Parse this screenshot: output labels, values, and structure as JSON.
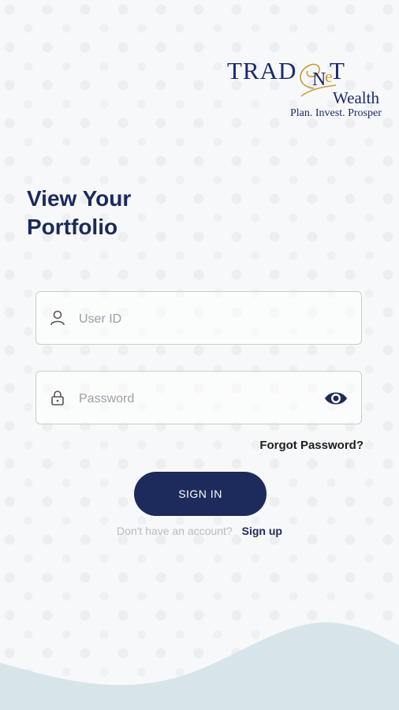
{
  "logo": {
    "brand_part1": "TRAD",
    "brand_part2": "ENET",
    "sub": "Wealth",
    "tagline": "Plan. Invest. Prosper"
  },
  "title_line1": "View Your",
  "title_line2": "Portfolio",
  "user_field": {
    "placeholder": "User ID",
    "value": "",
    "icon": "user-icon"
  },
  "password_field": {
    "placeholder": "Password",
    "value": "",
    "icon": "lock-icon",
    "toggle_icon": "eye-icon"
  },
  "forgot_label": "Forgot Password?",
  "signin_label": "SIGN IN",
  "signup_prompt": "Don't have an account?",
  "signup_link": "Sign up",
  "colors": {
    "primary": "#1c2b5c",
    "gold": "#c79a3a",
    "wave": "#d7e5ea",
    "background": "#f7f8f9"
  }
}
